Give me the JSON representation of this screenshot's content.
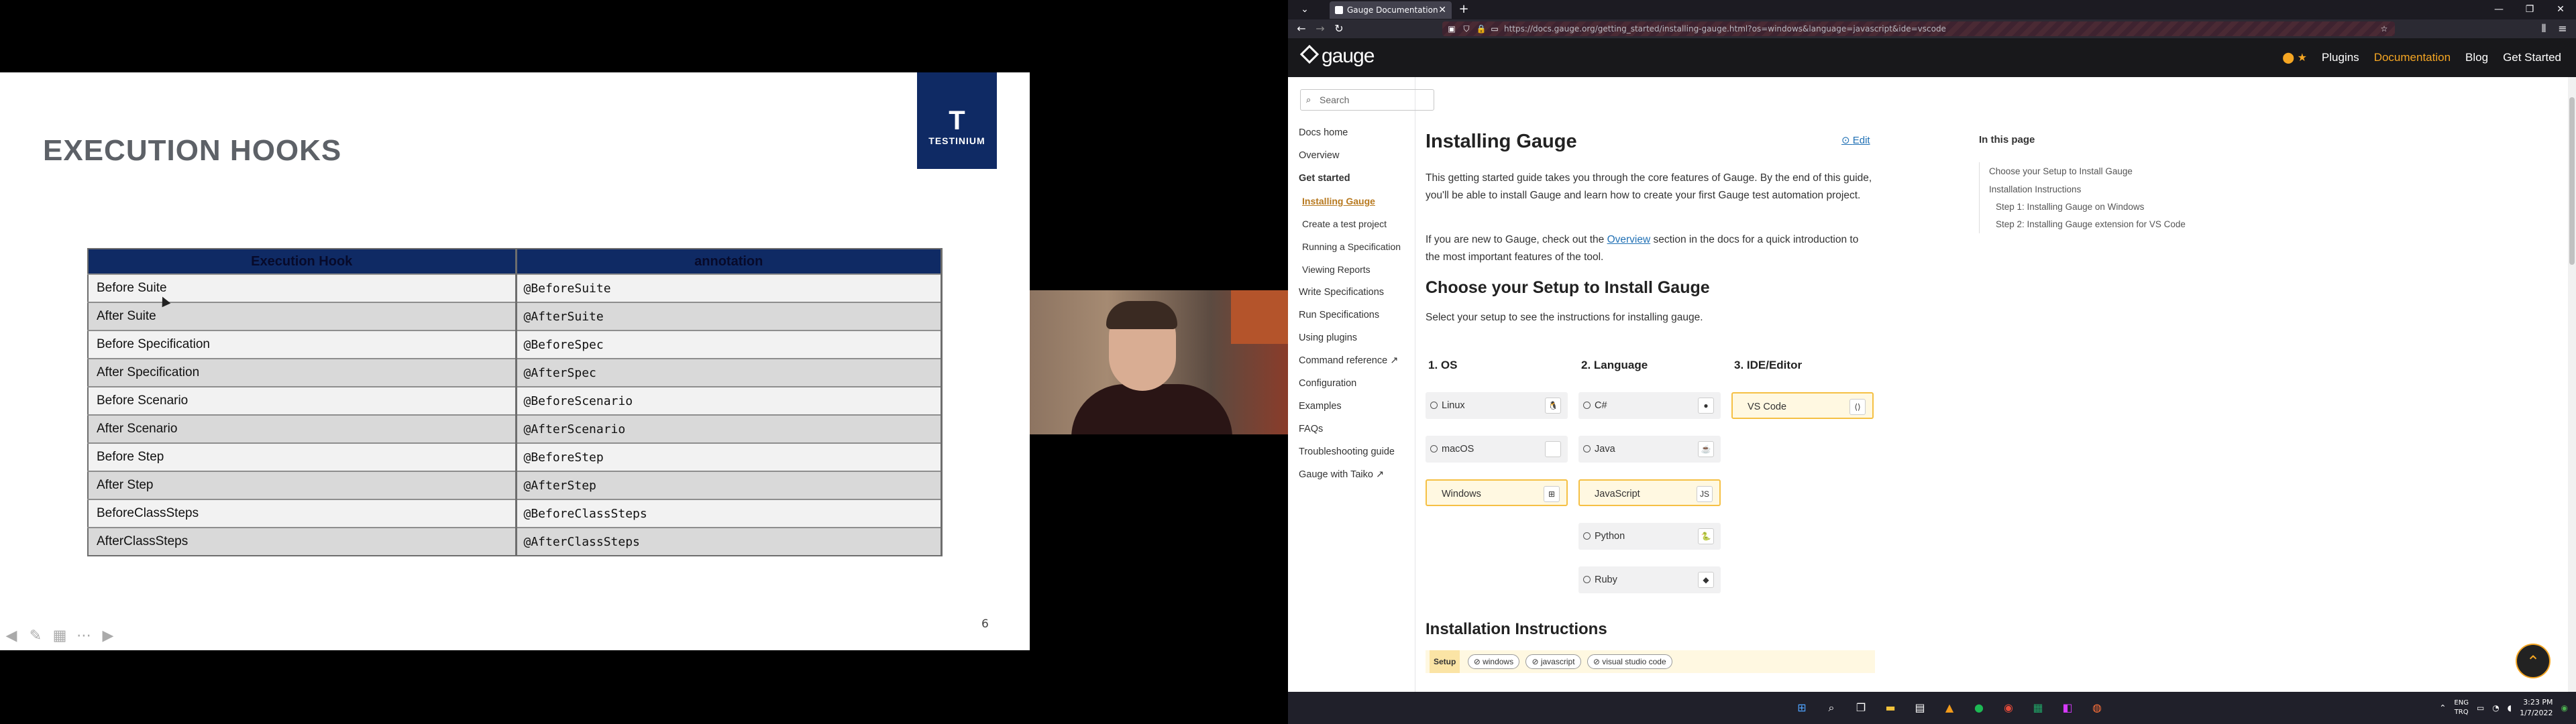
{
  "slide": {
    "title": "EXECUTION HOOKS",
    "logo_letter": "T",
    "logo_name": "TESTINIUM",
    "table_headers": [
      "Execution Hook",
      "annotation"
    ],
    "rows": [
      [
        "Before Suite",
        "@BeforeSuite"
      ],
      [
        "After Suite",
        "@AfterSuite"
      ],
      [
        "Before Specification",
        "@BeforeSpec"
      ],
      [
        "After Specification",
        "@AfterSpec"
      ],
      [
        "Before Scenario",
        "@BeforeScenario"
      ],
      [
        "After Scenario",
        "@AfterScenario"
      ],
      [
        "Before Step",
        "@BeforeStep"
      ],
      [
        "After Step",
        "@AfterStep"
      ],
      [
        "BeforeClassSteps",
        "@BeforeClassSteps"
      ],
      [
        "AfterClassSteps",
        "@AfterClassSteps"
      ]
    ],
    "page_number": "6",
    "nav_icons": [
      "prev-arrow-icon",
      "pen-icon",
      "slides-icon",
      "more-icon",
      "next-arrow-icon"
    ]
  },
  "browser": {
    "tab_title": "Gauge Documentation",
    "tab_close": "✕",
    "new_tab": "+",
    "url": "https://docs.gauge.org/getting_started/installing-gauge.html?os=windows&language=javascript&ide=vscode",
    "window_buttons": [
      "—",
      "❐",
      "✕"
    ]
  },
  "site": {
    "logo": "gauge",
    "nav": [
      "Plugins",
      "Documentation",
      "Blog",
      "Get Started"
    ],
    "github_star": "★",
    "search_placeholder": "Search",
    "sidebar": [
      {
        "label": "Docs home",
        "kind": "item"
      },
      {
        "label": "Overview",
        "kind": "item"
      },
      {
        "label": "Get started",
        "kind": "grp"
      },
      {
        "label": "Installing Gauge",
        "kind": "act"
      },
      {
        "label": "Create a test project",
        "kind": "sub"
      },
      {
        "label": "Running a Specification",
        "kind": "sub"
      },
      {
        "label": "Viewing Reports",
        "kind": "sub"
      },
      {
        "label": "Write Specifications",
        "kind": "item"
      },
      {
        "label": "Run Specifications",
        "kind": "item"
      },
      {
        "label": "Using plugins",
        "kind": "item"
      },
      {
        "label": "Command reference ↗",
        "kind": "item"
      },
      {
        "label": "Configuration",
        "kind": "item"
      },
      {
        "label": "Examples",
        "kind": "item"
      },
      {
        "label": "FAQs",
        "kind": "item"
      },
      {
        "label": "Troubleshooting guide",
        "kind": "item"
      },
      {
        "label": "Gauge with Taiko ↗",
        "kind": "item"
      }
    ],
    "article": {
      "title": "Installing Gauge",
      "edit": "Edit",
      "intro": "This getting started guide takes you through the core features of Gauge. By the end of this guide, you'll be able to install Gauge and learn how to create your first Gauge test automation project.",
      "new_pre": "If you are new to Gauge, check out the ",
      "new_link": "Overview",
      "new_post": " section in the docs for a quick introduction to the most important features of the tool.",
      "choose_heading": "Choose your Setup to Install Gauge",
      "select_text": "Select your setup to see the instructions for installing gauge.",
      "col_os": "1. OS",
      "col_lang": "2. Language",
      "col_ide": "3. IDE/Editor",
      "os_options": [
        "Linux",
        "macOS",
        "Windows"
      ],
      "lang_options": [
        "C#",
        "Java",
        "JavaScript",
        "Python",
        "Ruby"
      ],
      "ide_options": [
        "VS Code"
      ],
      "install_heading": "Installation Instructions",
      "setup_label": "Setup",
      "setup_chips": [
        "windows",
        "javascript",
        "visual studio code"
      ]
    },
    "toc": {
      "heading": "In this page",
      "items": [
        {
          "label": "Choose your Setup to Install Gauge",
          "level": 1
        },
        {
          "label": "Installation Instructions",
          "level": 1
        },
        {
          "label": "Step 1: Installing Gauge on Windows",
          "level": 2
        },
        {
          "label": "Step 2: Installing Gauge extension for VS Code",
          "level": 2
        }
      ]
    }
  },
  "taskbar": {
    "lang_top": "ENG",
    "lang_bottom": "TRQ",
    "time": "3:23 PM",
    "date": "1/7/2022"
  },
  "colors": {
    "accent": "#f5a623",
    "slide_header": "#0f2a64"
  }
}
